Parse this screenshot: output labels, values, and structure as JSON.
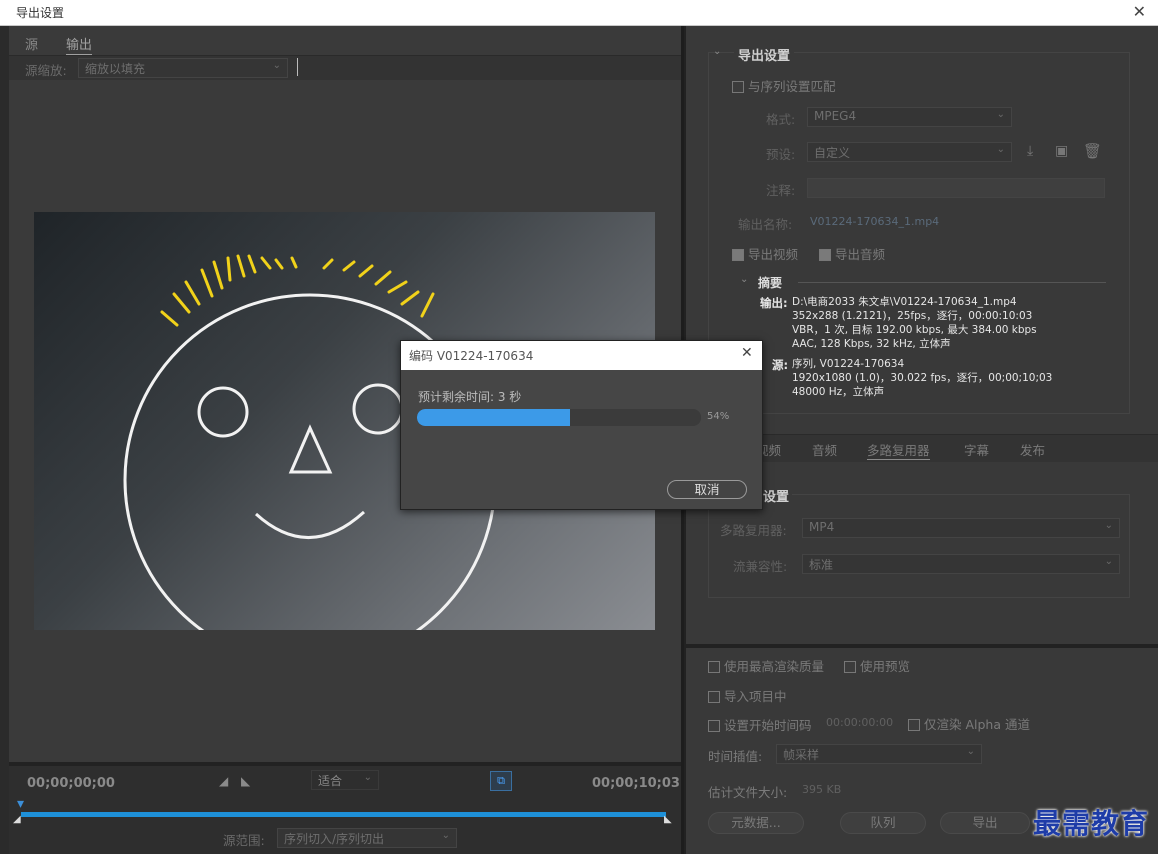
{
  "window": {
    "title": "导出设置"
  },
  "left": {
    "tabs": [
      "源",
      "输出"
    ],
    "source_scale_label": "源缩放:",
    "source_scale_value": "缩放以填充"
  },
  "timeline": {
    "start_tc": "00;00;00;00",
    "end_tc": "00;00;10;03",
    "fit_value": "适合",
    "range_label": "源范围:",
    "range_value": "序列切入/序列切出"
  },
  "export_settings": {
    "section_title": "导出设置",
    "match_sequence": "与序列设置匹配",
    "format_label": "格式:",
    "format_value": "MPEG4",
    "preset_label": "预设:",
    "preset_value": "自定义",
    "comment_label": "注释:",
    "output_name_label": "输出名称:",
    "output_name_value": "V01224-170634_1.mp4",
    "export_video": "导出视频",
    "export_audio": "导出音频",
    "summary_title": "摘要",
    "output_label": "输出:",
    "output_lines": [
      "D:\\电商2033 朱文卓\\V01224-170634_1.mp4",
      "352x288 (1.2121)，25fps，逐行，00:00:10:03",
      "VBR，1 次, 目标 192.00 kbps, 最大 384.00 kbps",
      "AAC, 128 Kbps, 32 kHz, 立体声"
    ],
    "source_label": "源:",
    "source_lines": [
      "序列, V01224-170634",
      "1920x1080 (1.0)，30.022 fps，逐行，00;00;10;03",
      "48000 Hz，立体声"
    ]
  },
  "subtabs": [
    "视频",
    "音频",
    "多路复用器",
    "字幕",
    "发布"
  ],
  "mux": {
    "section_title": "设置",
    "muxer_label": "多路复用器:",
    "muxer_value": "MP4",
    "compat_label": "流兼容性:",
    "compat_value": "标准"
  },
  "bottom": {
    "max_render": "使用最高渲染质量",
    "use_preview": "使用预览",
    "import_project": "导入项目中",
    "set_start_tc": "设置开始时间码",
    "start_tc_value": "00:00:00:00",
    "alpha_only": "仅渲染 Alpha 通道",
    "interp_label": "时间插值:",
    "interp_value": "帧采样",
    "est_size_label": "估计文件大小:",
    "est_size_value": "395 KB",
    "btn_metadata": "元数据...",
    "btn_queue": "队列",
    "btn_export": "导出"
  },
  "dialog": {
    "title": "编码 V01224-170634",
    "remaining": "预计剩余时间: 3 秒",
    "progress": 0.54,
    "percent_text": "54%",
    "cancel": "取消"
  },
  "watermark": "最需教育"
}
